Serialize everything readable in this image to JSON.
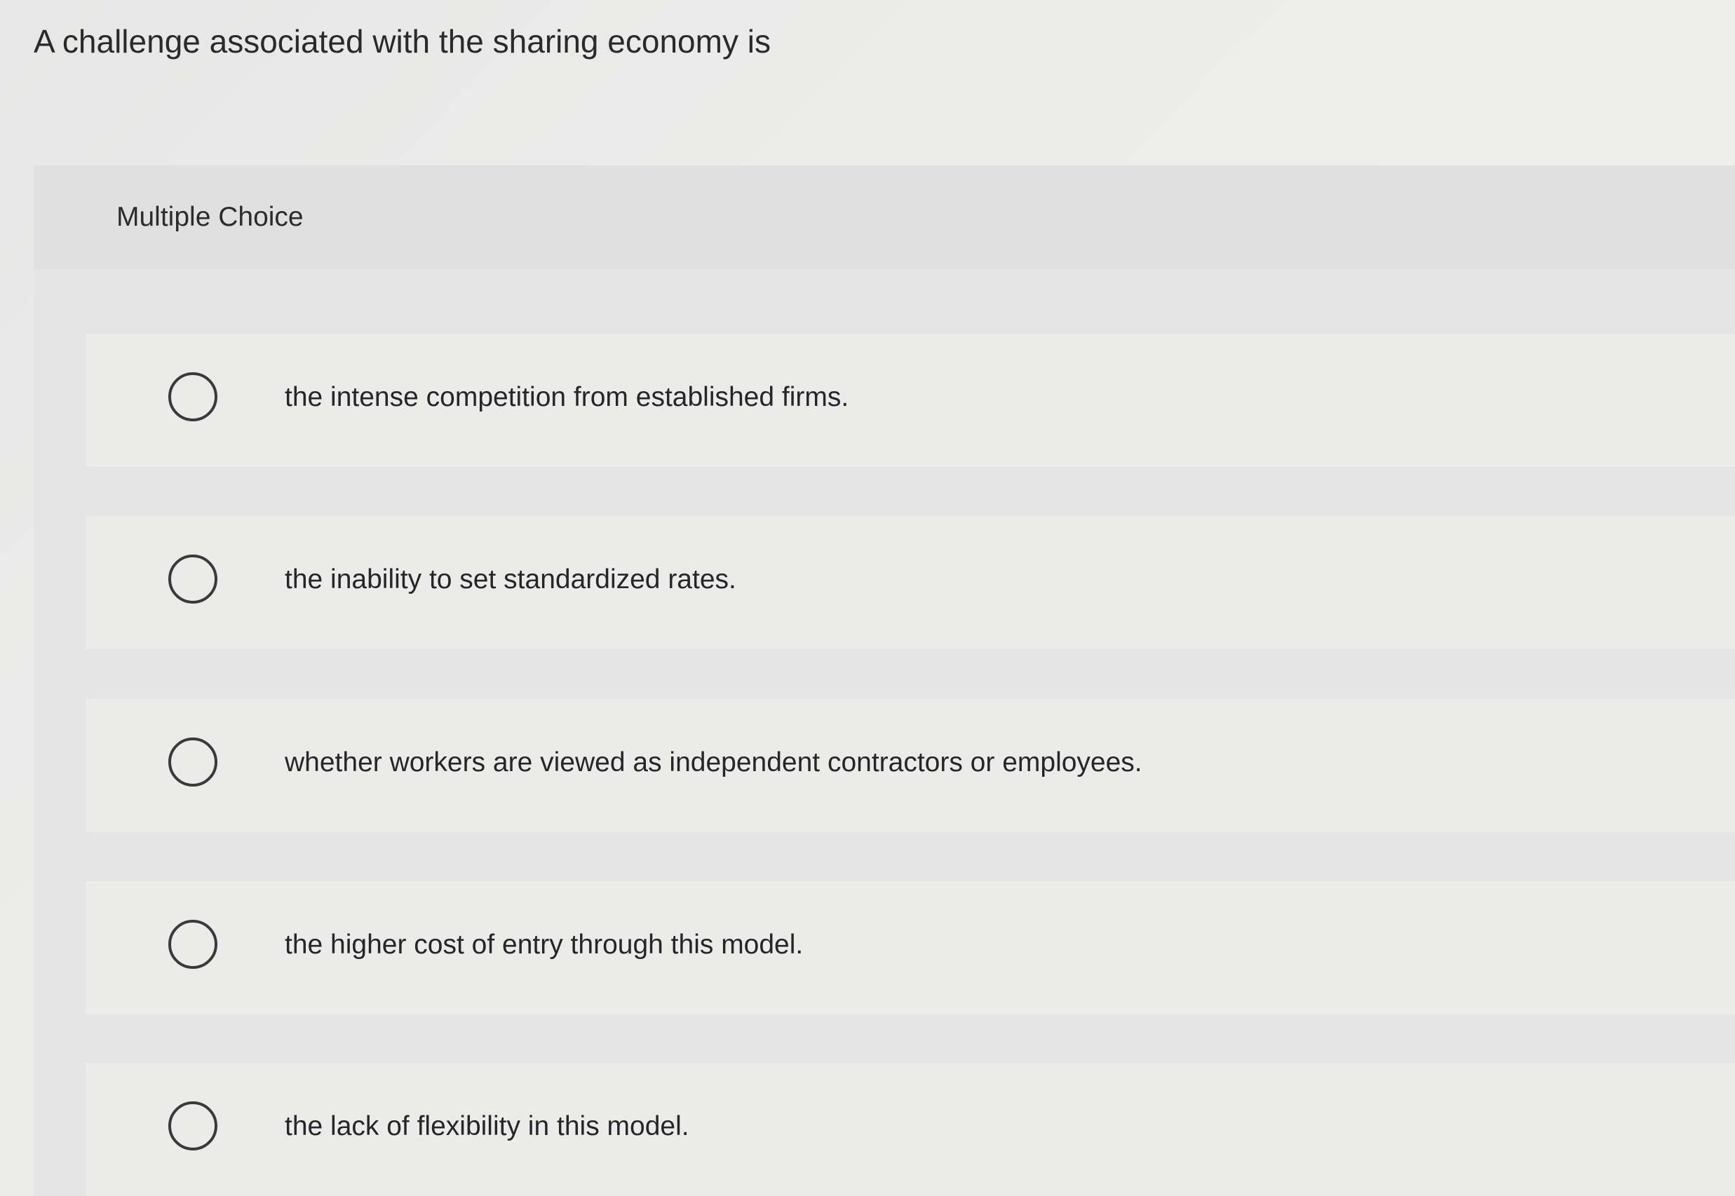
{
  "question": {
    "prompt": "A challenge associated with the sharing economy is"
  },
  "panel": {
    "label": "Multiple Choice"
  },
  "options": [
    {
      "label": "the intense competition from established firms.",
      "selected": false
    },
    {
      "label": "the inability to set standardized rates.",
      "selected": false
    },
    {
      "label": "whether workers are viewed as independent contractors or employees.",
      "selected": false
    },
    {
      "label": "the higher cost of entry through this model.",
      "selected": false
    },
    {
      "label": "the lack of flexibility in this model.",
      "selected": false
    }
  ]
}
